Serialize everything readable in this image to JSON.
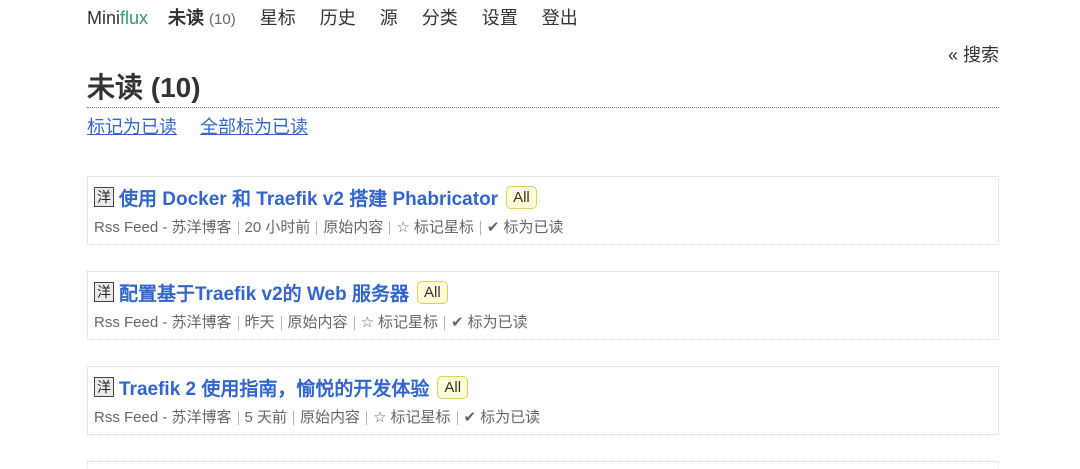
{
  "header": {
    "logo": {
      "mini": "Mini",
      "flux": "flux"
    },
    "nav": [
      {
        "label": "未读",
        "count": "(10)",
        "active": true
      },
      {
        "label": "星标"
      },
      {
        "label": "历史"
      },
      {
        "label": "源"
      },
      {
        "label": "分类"
      },
      {
        "label": "设置"
      },
      {
        "label": "登出"
      }
    ],
    "search_label": "« 搜索"
  },
  "page": {
    "title": "未读 (10)",
    "actions": [
      "标记为已读",
      "全部标为已读"
    ]
  },
  "item_actions": {
    "original": "原始内容",
    "star_icon": "☆",
    "star_label": "标记星标",
    "read_icon": "✔",
    "read_label": "标为已读"
  },
  "entries": [
    {
      "favicon_text": "洋",
      "title": "使用 Docker 和 Traefik v2 搭建 Phabricator",
      "category": "All",
      "feed": "Rss Feed - 苏洋博客",
      "time": "20 小时前"
    },
    {
      "favicon_text": "洋",
      "title": "配置基于Traefik v2的 Web 服务器",
      "category": "All",
      "feed": "Rss Feed - 苏洋博客",
      "time": "昨天"
    },
    {
      "favicon_text": "洋",
      "title": "Traefik 2 使用指南，愉悦的开发体验",
      "category": "All",
      "feed": "Rss Feed - 苏洋博客",
      "time": "5 天前"
    }
  ],
  "colors": {
    "link": "#3366cc",
    "logo_accent": "#339966",
    "category_background": "#fffcd7",
    "category_border": "#d5d458",
    "meta_text": "#666666"
  },
  "icons": [
    "feed-favicon-icon",
    "star-icon",
    "check-icon"
  ]
}
